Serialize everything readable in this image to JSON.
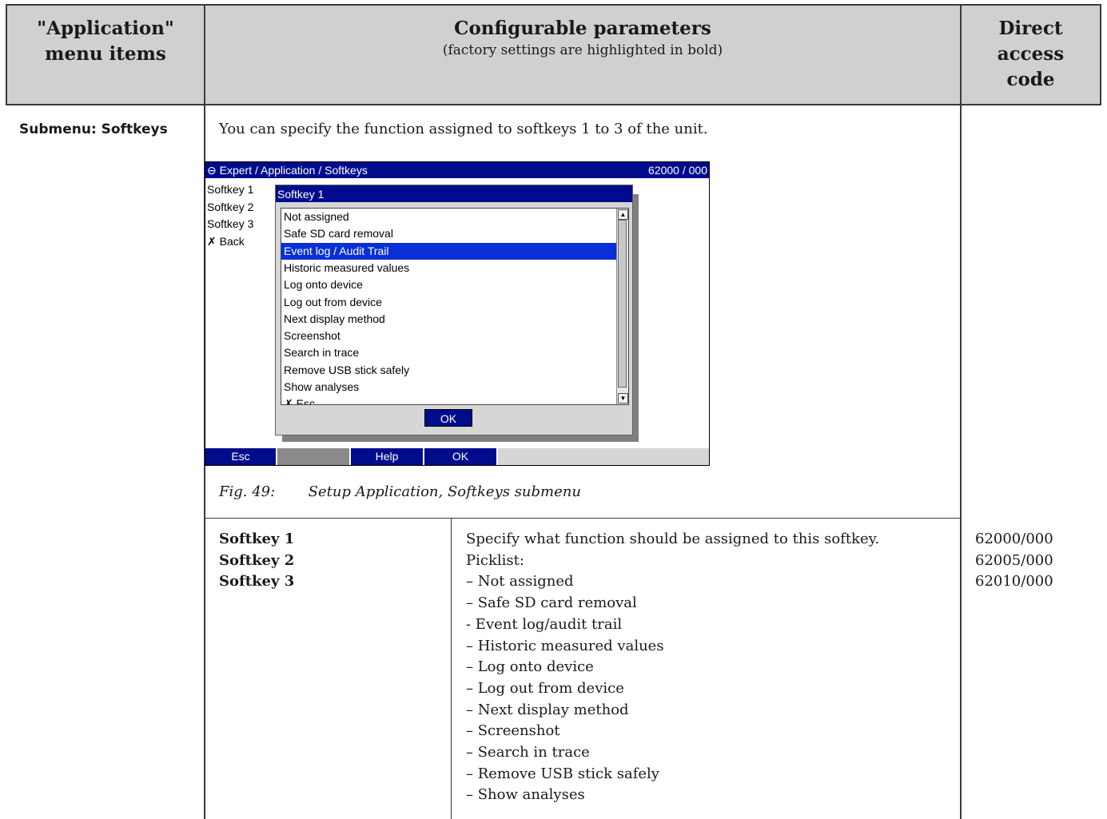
{
  "header": {
    "col1": [
      "\"Application\"",
      "menu items"
    ],
    "col2_title": "Configurable parameters",
    "col2_sub": "(factory settings are highlighted in bold)",
    "col3": [
      "Direct",
      "access",
      "code"
    ]
  },
  "submenu": {
    "label": "Submenu: Softkeys",
    "intro": "You can specify the function assigned to softkeys 1 to 3 of the unit."
  },
  "device": {
    "title": "⊖ Expert / Application / Softkeys",
    "code": "62000 / 000",
    "menu": [
      "Softkey 1",
      "Softkey 2",
      "Softkey 3",
      "✗ Back"
    ],
    "dialog_title": "Softkey 1",
    "list": [
      "Not assigned",
      "Safe SD card removal",
      "Event log / Audit Trail",
      "Historic measured values",
      "Log onto device",
      "Log out from device",
      "Next display method",
      "Screenshot",
      "Search in trace",
      "Remove USB stick safely",
      "Show analyses",
      "✗ Esc"
    ],
    "selected_index": 2,
    "ok": "OK",
    "softkeys": [
      "Esc",
      "",
      "Help",
      "OK"
    ]
  },
  "caption": {
    "num": "Fig. 49:",
    "text": "Setup Application, Softkeys submenu"
  },
  "param": {
    "names": [
      "Softkey 1",
      "Softkey 2",
      "Softkey 3"
    ],
    "desc": "Specify what function should be assigned to this softkey.",
    "picklist_label": "Picklist:",
    "options": [
      "– Not assigned",
      "– Safe SD card removal",
      "- Event log/audit trail",
      "– Historic measured values",
      "– Log onto device",
      "– Log out from device",
      "– Next display method",
      "– Screenshot",
      "– Search in trace",
      "– Remove USB stick safely",
      "– Show analyses"
    ],
    "codes": [
      "62000/000",
      "62005/000",
      "62010/000"
    ]
  }
}
